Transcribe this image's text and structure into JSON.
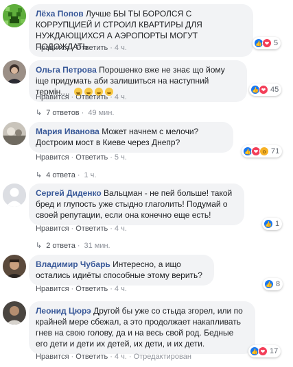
{
  "comments": [
    {
      "author": "Лёха Попов",
      "text": "Лучше БЫ ТЫ БОРОЛСЯ С КОРРУПЦИЕЙ И СТРОИЛ КВАРТИРЫ ДЛЯ НУЖДАЮЩИХСЯ А АЭРОПОРТЫ МОГУТ ПОДОЖДАТЬ",
      "like": "Нравится",
      "reply": "Ответить",
      "time": "4 ч.",
      "reaction_count": "5"
    },
    {
      "author": "Ольга Петрова",
      "text": "Порошенко вже не знає що йому іще придумать аби залишиться на наступний термін....",
      "like": "Нравится",
      "reply": "Ответить",
      "time": "4 ч.",
      "reaction_count": "45",
      "replies_label": "7 ответов",
      "replies_time": "49 мин."
    },
    {
      "author": "Мария Иванова",
      "text": "Может начнем с мелочи? Достроим мост в Киеве через Днепр?",
      "like": "Нравится",
      "reply": "Ответить",
      "time": "5 ч.",
      "reaction_count": "71",
      "replies_label": "4 ответа",
      "replies_time": "1 ч."
    },
    {
      "author": "Сергей Диденко",
      "text": "Вальцман - не пей больше! такой бред и глупость уже стыдно глаголить! Подумай о своей репутации, если она конечно еще есть!",
      "like": "Нравится",
      "reply": "Ответить",
      "time": "4 ч.",
      "reaction_count": "1",
      "replies_label": "2 ответа",
      "replies_time": "31 мин."
    },
    {
      "author": "Владимир Чубарь",
      "text": "Интересно, а ищо остались идиёты способные этому верить?",
      "like": "Нравится",
      "reply": "Ответить",
      "time": "4 ч.",
      "reaction_count": "8"
    },
    {
      "author": "Леонид Цюрэ",
      "text": "Другой бы уже со стыда згорел, или по крайней мере сбежал, а это продолжает накапливать гнев на свою голову, да и на весь свой род. Бедные его дети и дети их детей, их дети, и их дети.",
      "like": "Нравится",
      "reply": "Ответить",
      "time": "4 ч.",
      "edited": "Отредактирован",
      "reaction_count": "17"
    }
  ],
  "colors": {
    "author_link": "#385898",
    "bubble_bg": "#f2f3f5",
    "meta_text": "#90949c",
    "like_blue": "#1877f2",
    "love_red": "#f33e58",
    "wow_yellow": "#f7b125"
  },
  "icons": {
    "avatar_1": "green-pixel-avatar",
    "reaction_like": "thumbs-up-icon",
    "reaction_love": "heart-icon",
    "reaction_wow": "wow-face-icon",
    "reply_arrow": "reply-arrow-icon",
    "emoji": "laughing-emoji"
  }
}
